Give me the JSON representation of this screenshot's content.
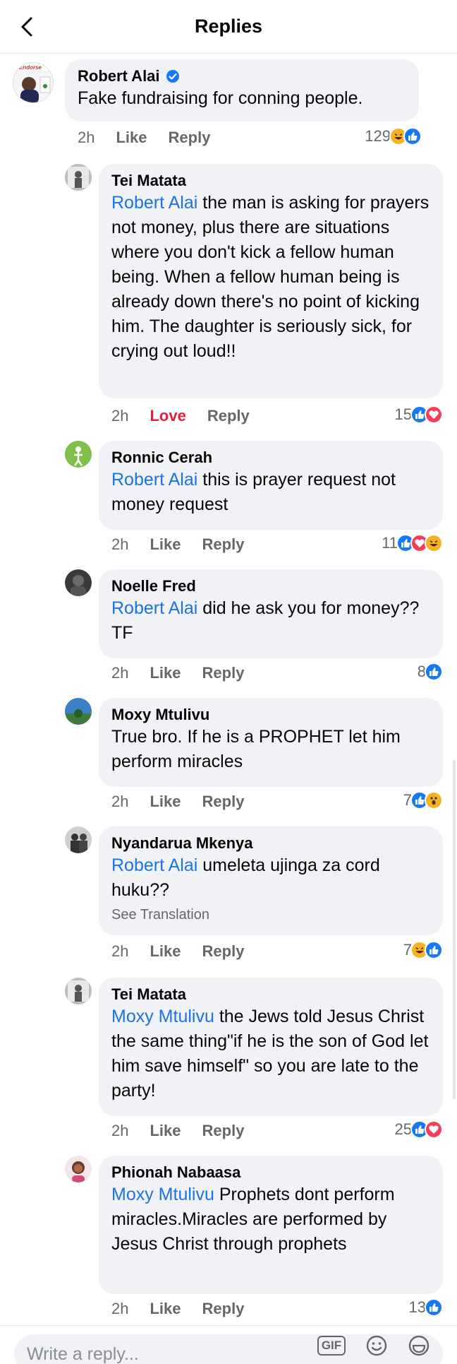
{
  "header": {
    "title": "Replies"
  },
  "parent": {
    "author": "Robert Alai",
    "text": "Fake fundraising for conning people.",
    "time": "2h",
    "like_label": "Like",
    "reply_label": "Reply",
    "reaction_count": "129",
    "reactions": [
      "haha-icon",
      "like-icon"
    ],
    "avatar_caption": "Endorse"
  },
  "replies": [
    {
      "author": "Tei Matata",
      "mention": "Robert Alai",
      "text": " the man is asking for prayers not money, plus there are situations where you don't kick a fellow human being. When a fellow human being is already down there's no point of kicking him. The daughter is seriously sick, for crying out loud!!",
      "time": "2h",
      "action": "Love",
      "reply_label": "Reply",
      "reaction_count": "15",
      "reactions": [
        "like-icon",
        "love-icon"
      ]
    },
    {
      "author": "Ronnic Cerah",
      "mention": "Robert Alai",
      "text": " this is prayer request not money request",
      "time": "2h",
      "action": "Like",
      "reply_label": "Reply",
      "reaction_count": "11",
      "reactions": [
        "like-icon",
        "love-icon",
        "haha-icon"
      ]
    },
    {
      "author": "Noelle Fred",
      "mention": "Robert Alai",
      "text": " did he ask you for money?? TF",
      "time": "2h",
      "action": "Like",
      "reply_label": "Reply",
      "reaction_count": "8",
      "reactions": [
        "like-icon"
      ]
    },
    {
      "author": "Moxy Mtulivu",
      "mention": "",
      "text": "True bro. If he is a PROPHET let him perform miracles",
      "time": "2h",
      "action": "Like",
      "reply_label": "Reply",
      "reaction_count": "7",
      "reactions": [
        "like-icon",
        "wow-icon"
      ]
    },
    {
      "author": "Nyandarua Mkenya",
      "mention": "Robert Alai",
      "text": " umeleta ujinga za cord huku??",
      "see_translation": "See Translation",
      "time": "2h",
      "action": "Like",
      "reply_label": "Reply",
      "reaction_count": "7",
      "reactions": [
        "haha-icon",
        "like-icon"
      ]
    },
    {
      "author": "Tei Matata",
      "mention": "Moxy Mtulivu",
      "text": " the Jews told Jesus Christ the same thing\"if he is the son of God let him save himself\" so you are late to the party!",
      "time": "2h",
      "action": "Like",
      "reply_label": "Reply",
      "reaction_count": "25",
      "reactions": [
        "like-icon",
        "love-icon"
      ]
    },
    {
      "author": "Phionah Nabaasa",
      "mention": "Moxy Mtulivu",
      "text": "  Prophets dont perform miracles.Miracles are performed by  Jesus Christ through prophets",
      "time": "2h",
      "action": "Like",
      "reply_label": "Reply",
      "reaction_count": "13",
      "reactions": [
        "like-icon"
      ]
    }
  ],
  "reply_bar": {
    "placeholder": "Write a reply...",
    "gif_label": "GIF"
  },
  "colors": {
    "mention": "#1b74e4",
    "love": "#e41e3f",
    "bubble": "#f0f2f5",
    "like_blue": "#1877f2"
  }
}
